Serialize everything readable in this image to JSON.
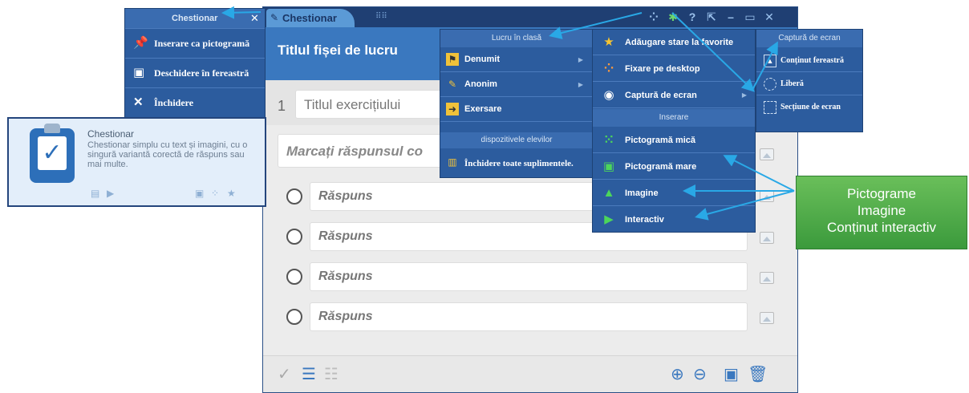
{
  "window": {
    "tab_label": "Chestionar",
    "tab_grid_icon": "grid-icon",
    "controls": [
      "customize-icon",
      "tools-icon",
      "help-icon",
      "popout-icon",
      "minimize-icon",
      "maximize-icon",
      "close-icon"
    ]
  },
  "worksheet": {
    "title": "Titlul fișei de lucru",
    "exercise_number": "1",
    "exercise_placeholder": "Titlul exercițiului",
    "question_placeholder": "Marcați răspunsul co",
    "answers": [
      "Răspuns",
      "Răspuns",
      "Răspuns",
      "Răspuns"
    ]
  },
  "footer": {
    "icons": [
      "check-icon",
      "list-icon",
      "grid-list-icon",
      "add-icon",
      "remove-icon",
      "save-icon",
      "trash-icon"
    ]
  },
  "left_menu": {
    "title": "Chestionar",
    "items": [
      {
        "label": "Inserare ca pictogramă",
        "icon": "pin-icon"
      },
      {
        "label": "Deschidere în fereastră",
        "icon": "window-icon"
      },
      {
        "label": "Închidere",
        "icon": "close-x-icon"
      }
    ]
  },
  "card": {
    "title": "Chestionar",
    "description": "Chestionar simplu cu text și imagini, cu o singură variantă corectă de răspuns sau mai multe."
  },
  "class_menu": {
    "header": "Lucru în clasă",
    "items": [
      {
        "label": "Denumit",
        "has_submenu": true,
        "icon": "named-icon"
      },
      {
        "label": "Anonim",
        "has_submenu": true,
        "icon": "anonymous-icon"
      },
      {
        "label": "Exersare",
        "has_submenu": false,
        "icon": "practice-icon"
      }
    ],
    "devices_header": "dispozitivele elevilor",
    "devices_item": "Închidere toate suplimentele."
  },
  "fav_menu": {
    "items": [
      {
        "label": "Adăugare stare la favorite",
        "icon": "star-icon"
      },
      {
        "label": "Fixare pe desktop",
        "icon": "desktop-pin-icon"
      },
      {
        "label": "Captură de ecran",
        "icon": "camera-icon",
        "has_submenu": true
      }
    ],
    "insert_header": "Inserare",
    "insert_items": [
      {
        "label": "Pictogramă mică",
        "icon": "small-icon"
      },
      {
        "label": "Pictogramă mare",
        "icon": "large-icon"
      },
      {
        "label": "Imagine",
        "icon": "image-icon"
      },
      {
        "label": "Interactiv",
        "icon": "interactive-icon"
      }
    ]
  },
  "screenshot_menu": {
    "header": "Captură de ecran",
    "items": [
      {
        "label": "Conținut fereastră",
        "icon": "window-capture-icon"
      },
      {
        "label": "Liberă",
        "icon": "freeform-icon"
      },
      {
        "label": "Secțiune de ecran",
        "icon": "region-icon"
      }
    ]
  },
  "callout": {
    "lines": [
      "Pictograme",
      "Imagine",
      "Conținut interactiv"
    ]
  },
  "colors": {
    "menu_bg": "#2c5c9e",
    "header_blue": "#3a78bf",
    "callout_green": "#4caf45",
    "arrow": "#29a8e6"
  }
}
